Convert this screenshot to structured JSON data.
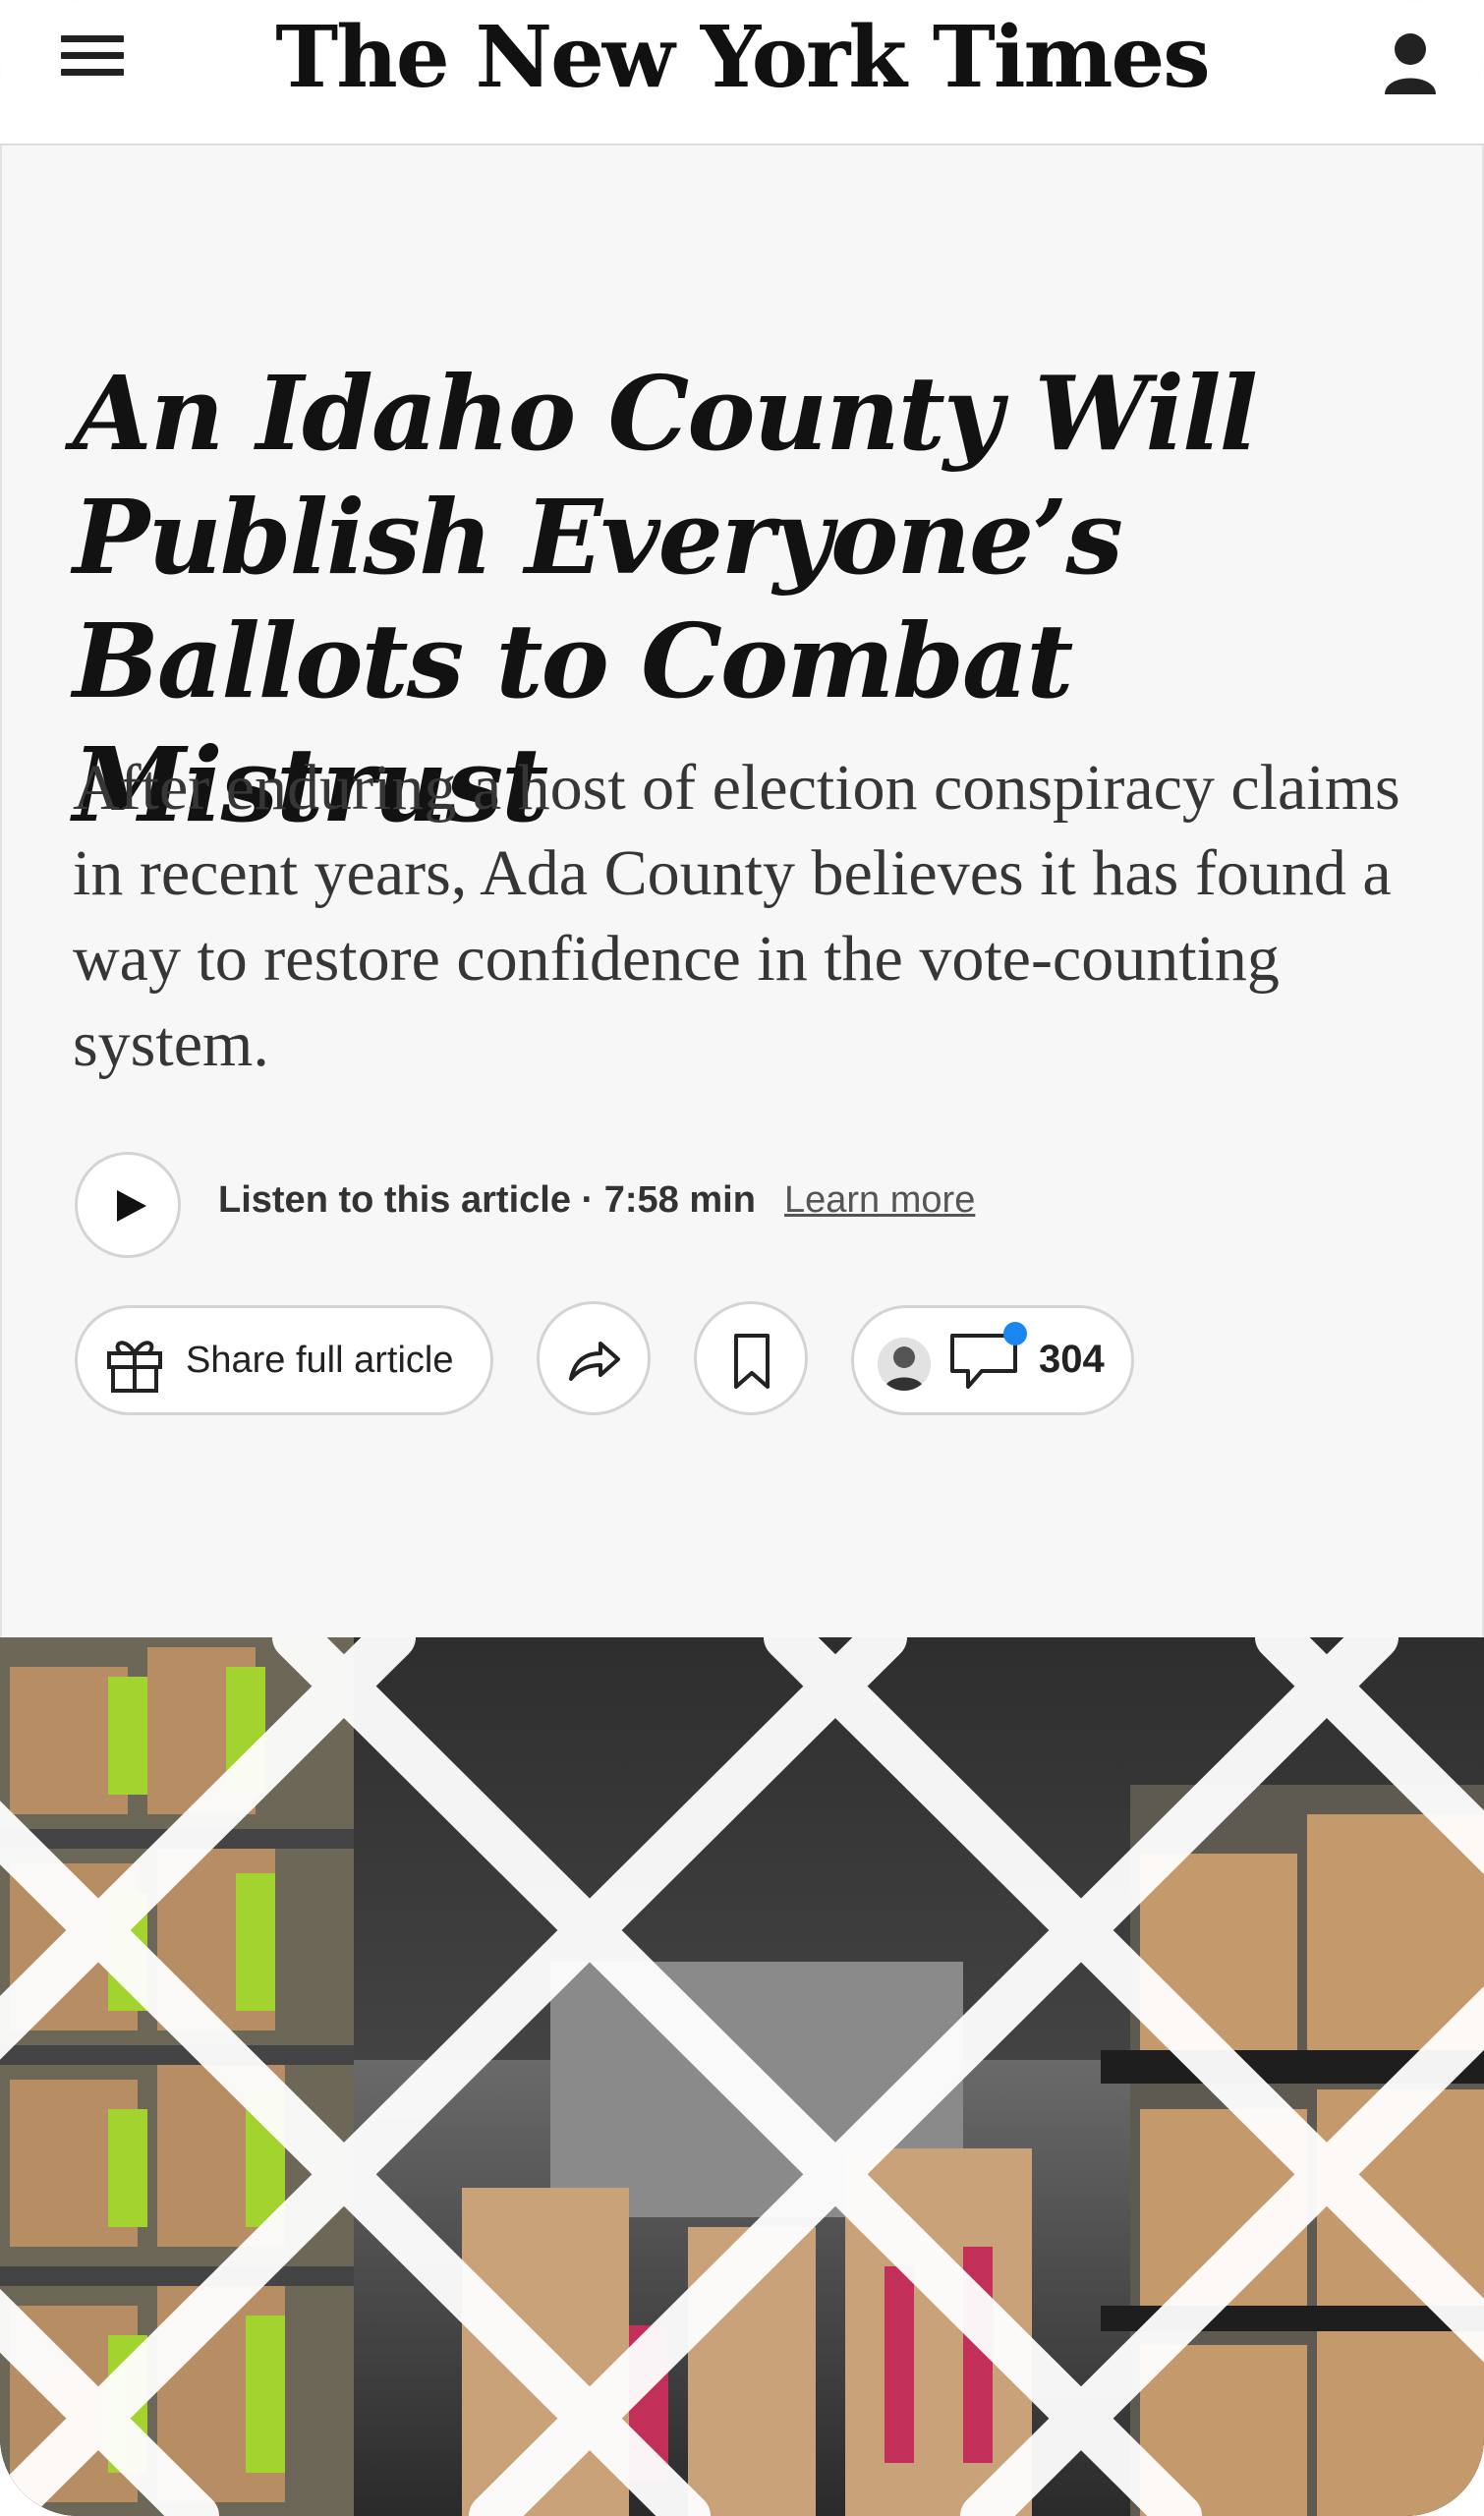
{
  "masthead": {
    "logo_text": "The New York Times"
  },
  "article": {
    "headline": "An Idaho County Will Publish Everyone’s Ballots to Combat Mistrust",
    "summary": "After enduring a host of election conspiracy claims in recent years, Ada County believes it has found a way to restore confidence in the vote-counting system."
  },
  "audio": {
    "listen_label": "Listen to this article · 7:58 min",
    "learn_more": "Learn more"
  },
  "actions": {
    "share_label": "Share full article",
    "comment_count": "304"
  },
  "icons": {
    "menu": "hamburger-menu-icon",
    "account": "user-account-icon",
    "play": "play-icon",
    "gift": "gift-icon",
    "forward": "forward-share-icon",
    "save": "bookmark-icon",
    "comment": "comment-bubble-icon"
  },
  "colors": {
    "notification_dot": "#1a86f0",
    "page_bg": "#f7f7f7",
    "text": "#121212"
  }
}
